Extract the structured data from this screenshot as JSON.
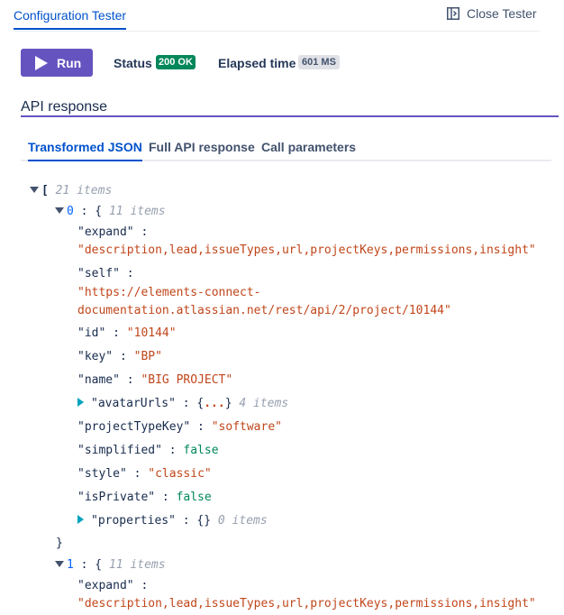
{
  "header": {
    "tab_title": "Configuration Tester",
    "close_label": "Close Tester"
  },
  "toolbar": {
    "run_label": "Run",
    "status_label": "Status",
    "status_value": "200 OK",
    "elapsed_label": "Elapsed time",
    "elapsed_value": "601 MS"
  },
  "section": {
    "title": "API response"
  },
  "tabs": [
    {
      "label": "Transformed JSON",
      "active": true
    },
    {
      "label": "Full API response",
      "active": false
    },
    {
      "label": "Call parameters",
      "active": false
    }
  ],
  "json": {
    "root_count": "21 items",
    "item0": {
      "index": "0",
      "count": "11 items",
      "expand_key": "\"expand\"",
      "expand_val": "\"description,lead,issueTypes,url,projectKeys,permissions,insight\"",
      "self_key": "\"self\"",
      "self_val_line1": "\"https://elements-connect-",
      "self_val_line2": "documentation.atlassian.net/rest/api/2/project/10144\"",
      "id_key": "\"id\"",
      "id_val": "\"10144\"",
      "key_key": "\"key\"",
      "key_val": "\"BP\"",
      "name_key": "\"name\"",
      "name_val": "\"BIG PROJECT\"",
      "avatar_key": "\"avatarUrls\"",
      "avatar_ellipsis": "...",
      "avatar_count": "4 items",
      "ptk_key": "\"projectTypeKey\"",
      "ptk_val": "\"software\"",
      "simplified_key": "\"simplified\"",
      "simplified_val": "false",
      "style_key": "\"style\"",
      "style_val": "\"classic\"",
      "private_key": "\"isPrivate\"",
      "private_val": "false",
      "props_key": "\"properties\"",
      "props_val": "{}",
      "props_count": "0 items"
    },
    "item1": {
      "index": "1",
      "count": "11 items",
      "expand_key": "\"expand\"",
      "expand_val": "\"description,lead,issueTypes,url,projectKeys,permissions,insight\""
    }
  },
  "colors": {
    "accent": "#6554c0",
    "link": "#0052cc",
    "success": "#00875a",
    "string": "#c1461a"
  }
}
